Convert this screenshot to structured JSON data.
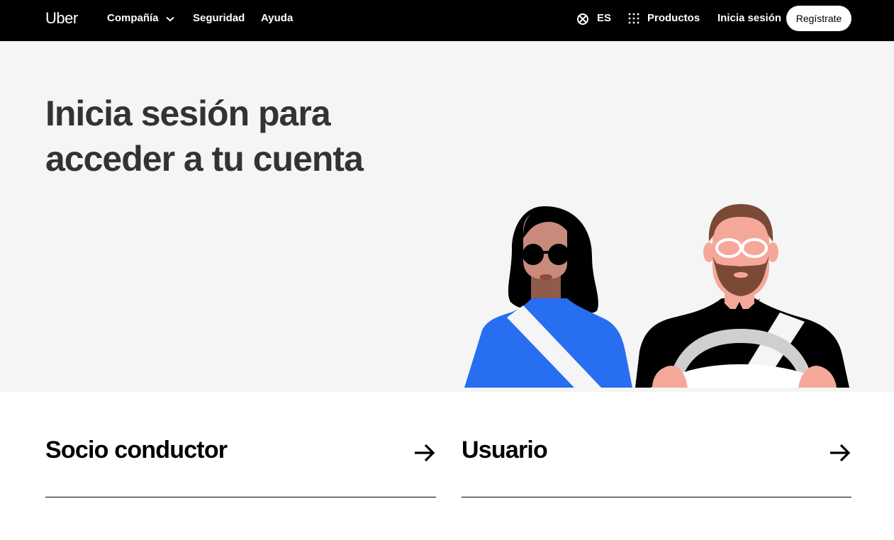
{
  "header": {
    "logo": "Uber",
    "nav": {
      "company": "Compañía",
      "safety": "Seguridad",
      "help": "Ayuda"
    },
    "language": "ES",
    "products": "Productos",
    "login": "Inicia sesión",
    "signup": "Regístrate"
  },
  "hero": {
    "title": "Inicia sesión para acceder a tu cuenta"
  },
  "options": [
    {
      "label": "Socio conductor",
      "icon": "arrow-right-icon"
    },
    {
      "label": "Usuario",
      "icon": "arrow-right-icon"
    }
  ],
  "colors": {
    "header_bg": "#000000",
    "hero_bg": "#f5f5f5",
    "rider_shirt": "#276ef1"
  }
}
